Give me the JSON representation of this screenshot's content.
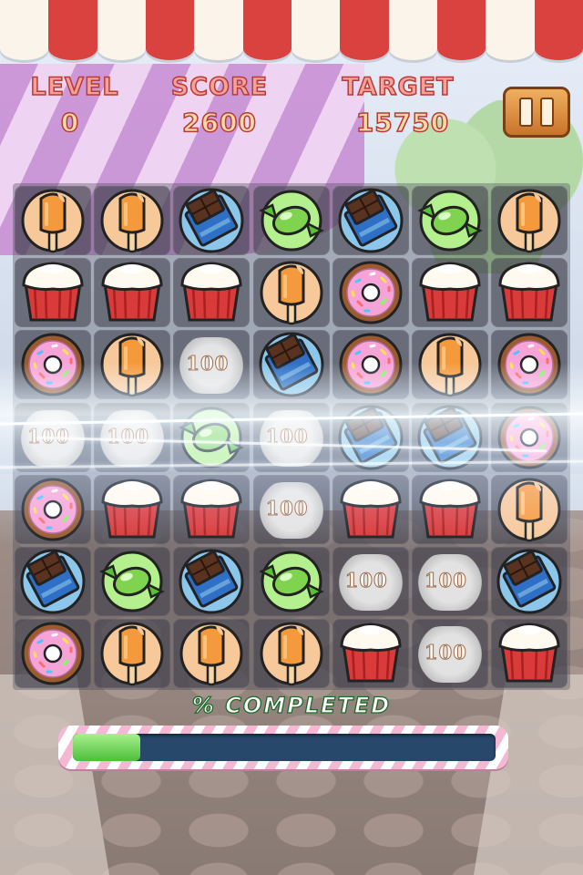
{
  "hud": {
    "level_label": "LEVEL",
    "level_value": "0",
    "score_label": "SCORE",
    "score_value": "2600",
    "target_label": "TARGET",
    "target_value": "15750",
    "pause_icon": "pause-icon"
  },
  "board": {
    "rows": 7,
    "cols": 7,
    "grid": [
      [
        "popsicle",
        "popsicle",
        "chocolate",
        "candy",
        "chocolate",
        "candy",
        "popsicle"
      ],
      [
        "cupcake",
        "cupcake",
        "cupcake",
        "popsicle",
        "donut",
        "cupcake",
        "cupcake"
      ],
      [
        "donut",
        "popsicle",
        "cleared",
        "chocolate",
        "donut",
        "popsicle",
        "donut"
      ],
      [
        "cleared",
        "cleared",
        "candy",
        "cleared",
        "chocolate",
        "chocolate",
        "donut"
      ],
      [
        "donut",
        "cupcake",
        "cupcake",
        "cleared",
        "cupcake",
        "cupcake",
        "popsicle"
      ],
      [
        "chocolate",
        "candy",
        "chocolate",
        "candy",
        "cleared",
        "cleared",
        "chocolate"
      ],
      [
        "donut",
        "popsicle",
        "popsicle",
        "popsicle",
        "cupcake",
        "cleared",
        "cupcake"
      ]
    ],
    "point_popups": [
      {
        "text": "100",
        "row": 2,
        "col": 2
      },
      {
        "text": "100",
        "row": 3,
        "col": 0
      },
      {
        "text": "100",
        "row": 3,
        "col": 1
      },
      {
        "text": "100",
        "row": 3,
        "col": 3
      },
      {
        "text": "100",
        "row": 4,
        "col": 3
      },
      {
        "text": "100",
        "row": 5,
        "col": 4
      },
      {
        "text": "100",
        "row": 5,
        "col": 5
      },
      {
        "text": "100",
        "row": 6,
        "col": 5
      }
    ],
    "piece_colors": {
      "popsicle": "#f59a3c",
      "chocolate": "#5a3320",
      "candy": "#7fd34e",
      "cupcake": "#d93a3a",
      "donut": "#f6a4d8"
    }
  },
  "progress": {
    "label": "% COMPLETED",
    "fraction": 0.16
  }
}
